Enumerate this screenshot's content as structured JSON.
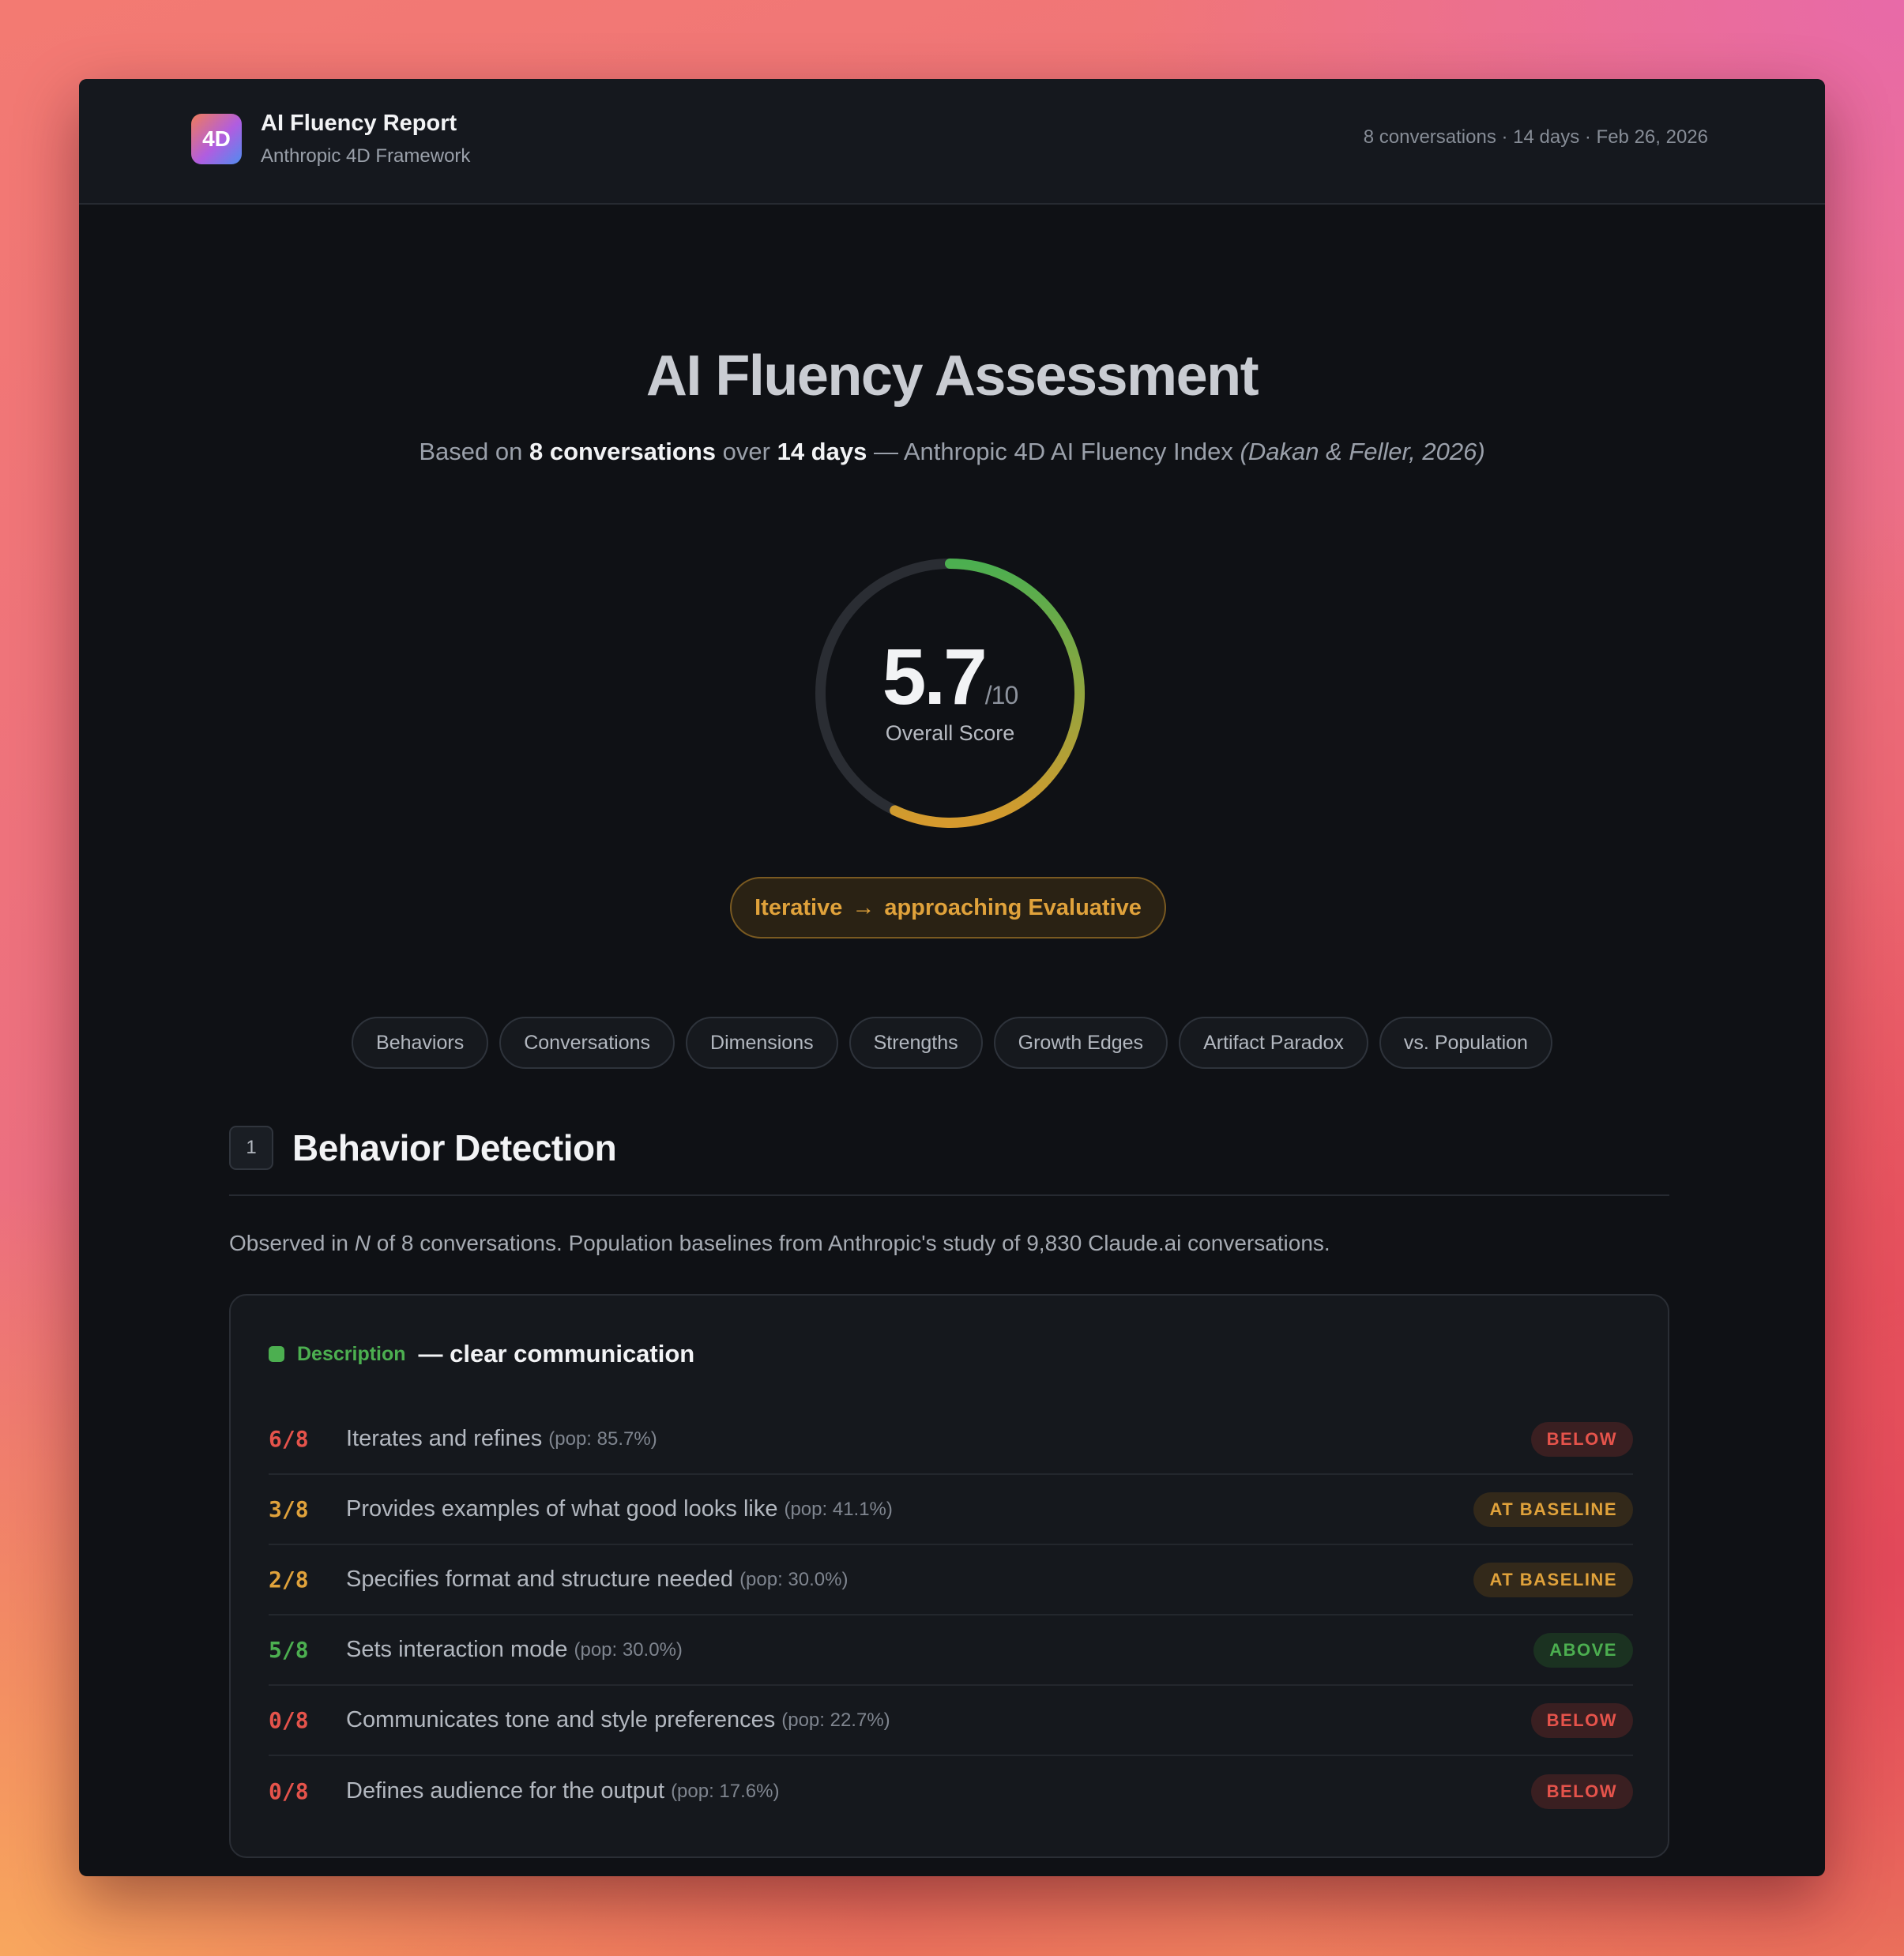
{
  "header": {
    "logo_text": "4D",
    "app_title": "AI Fluency Report",
    "app_subtitle": "Anthropic 4D Framework",
    "meta": "8 conversations · 14 days · Feb 26, 2026"
  },
  "hero": {
    "title": "AI Fluency Assessment",
    "sub_prefix": "Based on",
    "sub_conversations": "8 conversations",
    "sub_over": "over",
    "sub_days": "14 days",
    "sub_index": "— Anthropic 4D AI Fluency Index",
    "sub_citation": "(Dakan & Feller, 2026)"
  },
  "score": {
    "value": "5.7",
    "denominator": "/10",
    "label": "Overall Score",
    "fraction": 0.57,
    "colors": {
      "start": "#4caf50",
      "end": "#d69a2d",
      "track": "#2a2d33"
    }
  },
  "level_badge": {
    "from": "Iterative",
    "arrow": "→",
    "to": "approaching Evaluative"
  },
  "tabs": [
    "Behaviors",
    "Conversations",
    "Dimensions",
    "Strengths",
    "Growth Edges",
    "Artifact Paradox",
    "vs. Population"
  ],
  "section": {
    "number": "1",
    "title": "Behavior Detection",
    "desc_prefix": "Observed in",
    "desc_n": "N",
    "desc_suffix": "of 8 conversations. Population baselines from Anthropic's study of 9,830 Claude.ai conversations."
  },
  "card": {
    "dimension": "Description",
    "tagline": "— clear communication",
    "rows": [
      {
        "frac": "6/8",
        "label": "Iterates and refines",
        "pop": "(pop: 85.7%)",
        "status": "BELOW",
        "color": "#e5534b"
      },
      {
        "frac": "3/8",
        "label": "Provides examples of what good looks like",
        "pop": "(pop: 41.1%)",
        "status": "AT BASELINE",
        "color": "#e0a23b"
      },
      {
        "frac": "2/8",
        "label": "Specifies format and structure needed",
        "pop": "(pop: 30.0%)",
        "status": "AT BASELINE",
        "color": "#e0a23b"
      },
      {
        "frac": "5/8",
        "label": "Sets interaction mode",
        "pop": "(pop: 30.0%)",
        "status": "ABOVE",
        "color": "#4caf50"
      },
      {
        "frac": "0/8",
        "label": "Communicates tone and style preferences",
        "pop": "(pop: 22.7%)",
        "status": "BELOW",
        "color": "#e5534b"
      },
      {
        "frac": "0/8",
        "label": "Defines audience for the output",
        "pop": "(pop: 17.6%)",
        "status": "BELOW",
        "color": "#e5534b"
      }
    ]
  }
}
